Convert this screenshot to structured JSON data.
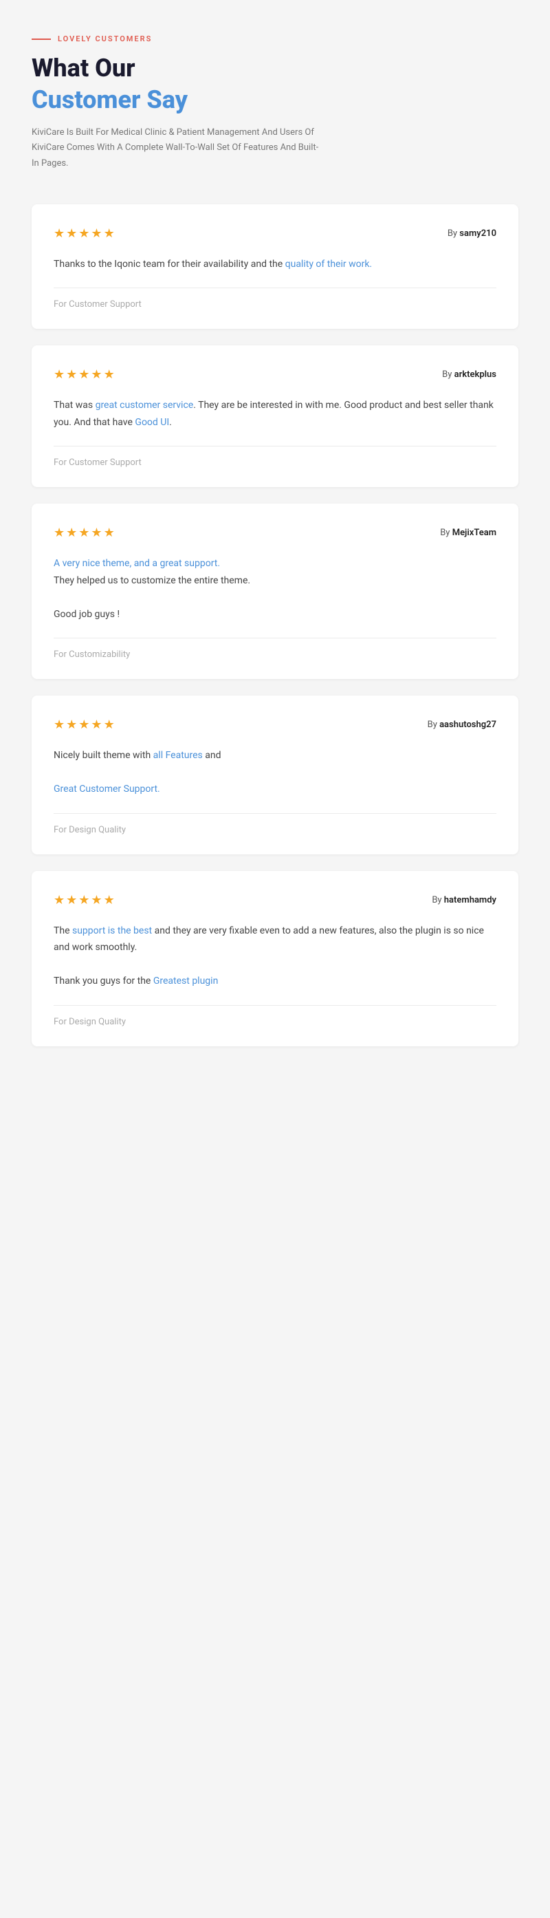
{
  "header": {
    "label_line": "—",
    "label_text": "LOVELY CUSTOMERS",
    "heading_line1": "What Our",
    "heading_line2": "Customer Say",
    "description": "KiviCare Is Built For Medical Clinic & Patient Management And Users Of KiviCare Comes With A Complete Wall-To-Wall Set Of Features And Built-In Pages."
  },
  "reviews": [
    {
      "stars": 5,
      "author": "samy210",
      "body_parts": [
        {
          "text": "Thanks to the Iqonic team for their availability and the ",
          "type": "plain"
        },
        {
          "text": "quality of their work.",
          "type": "link"
        },
        {
          "text": "",
          "type": "plain"
        }
      ],
      "body_plain": "Thanks to the Iqonic team for their availability and the quality of their work.",
      "for_label": "For",
      "for_value": "Customer Support"
    },
    {
      "stars": 5,
      "author": "arktekplus",
      "body_parts": [
        {
          "text": "That was ",
          "type": "plain"
        },
        {
          "text": "great customer service",
          "type": "link"
        },
        {
          "text": ". They are be interested in with me. Good product and best seller thank you. And that have ",
          "type": "plain"
        },
        {
          "text": "Good UI",
          "type": "link"
        },
        {
          "text": ".",
          "type": "plain"
        }
      ],
      "body_plain": "That was great customer service. They are be interested in with me. Good product and best seller thank you. And that have Good UI.",
      "for_label": "For",
      "for_value": "Customer Support"
    },
    {
      "stars": 5,
      "author": "MejixTeam",
      "body_parts": [
        {
          "text": "A very nice theme, and a great support.",
          "type": "link"
        },
        {
          "text": "\nThey helped us to customize the entire theme.\n\nGood job guys !",
          "type": "plain"
        }
      ],
      "body_plain": "A very nice theme, and a great support.\nThey helped us to customize the entire theme.\n\nGood job guys !",
      "for_label": "For",
      "for_value": "Customizability"
    },
    {
      "stars": 5,
      "author": "aashutoshg27",
      "body_parts": [
        {
          "text": "Nicely built theme with ",
          "type": "plain"
        },
        {
          "text": "all Features",
          "type": "link"
        },
        {
          "text": " and \n\n",
          "type": "plain"
        },
        {
          "text": "Great Customer Support.",
          "type": "link"
        },
        {
          "text": "",
          "type": "plain"
        }
      ],
      "body_plain": "Nicely built theme with all Features and\n\nGreat Customer Support.",
      "for_label": "For",
      "for_value": "Design Quality"
    },
    {
      "stars": 5,
      "author": "hatemhamdy",
      "body_parts": [
        {
          "text": "The ",
          "type": "plain"
        },
        {
          "text": "support is the best",
          "type": "link"
        },
        {
          "text": " and they are very fixable even to add a new features, also the plugin is so nice and work smoothly.\n\nThank you guys for the ",
          "type": "plain"
        },
        {
          "text": "Greatest plugin",
          "type": "link"
        },
        {
          "text": "",
          "type": "plain"
        }
      ],
      "body_plain": "The support is the best and they are very fixable even to add a new features, also the plugin is so nice and work smoothly.\n\nThank you guys for the Greatest plugin",
      "for_label": "For",
      "for_value": "Design Quality"
    }
  ]
}
